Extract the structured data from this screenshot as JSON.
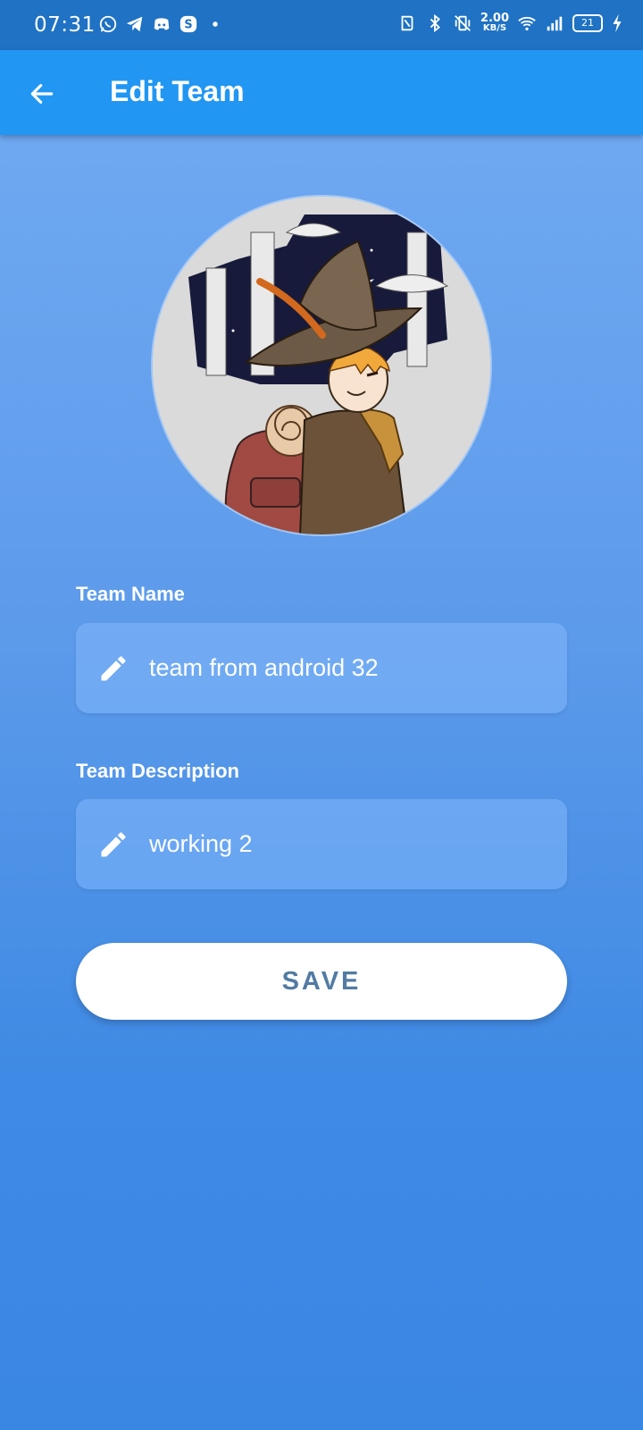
{
  "status_bar": {
    "time": "07:31",
    "left_icons": [
      "whatsapp-icon",
      "telegram-icon",
      "discord-icon",
      "skype-icon",
      "dot-icon"
    ],
    "right_icons": [
      "nfc-icon",
      "bluetooth-icon",
      "vibrate-off-icon",
      "netspeed",
      "wifi-icon",
      "signal-icon",
      "battery-icon",
      "charging-icon"
    ],
    "net_speed_value": "2.00",
    "net_speed_unit": "KB/S",
    "battery_level": "21"
  },
  "app_bar": {
    "title": "Edit Team",
    "back_icon": "arrow-back-icon"
  },
  "avatar": {
    "icon": "team-avatar-image"
  },
  "form": {
    "team_name_label": "Team Name",
    "team_name_value": "team from android 32",
    "team_description_label": "Team Description",
    "team_description_value": "working 2",
    "field_icon": "pencil-icon"
  },
  "save_label": "SAVE",
  "colors": {
    "app_bar": "#2196f3",
    "status_bar": "#1f72c4",
    "background_top": "#73acf3",
    "background_bottom": "#3a86e3",
    "save_text": "#527ba3"
  }
}
